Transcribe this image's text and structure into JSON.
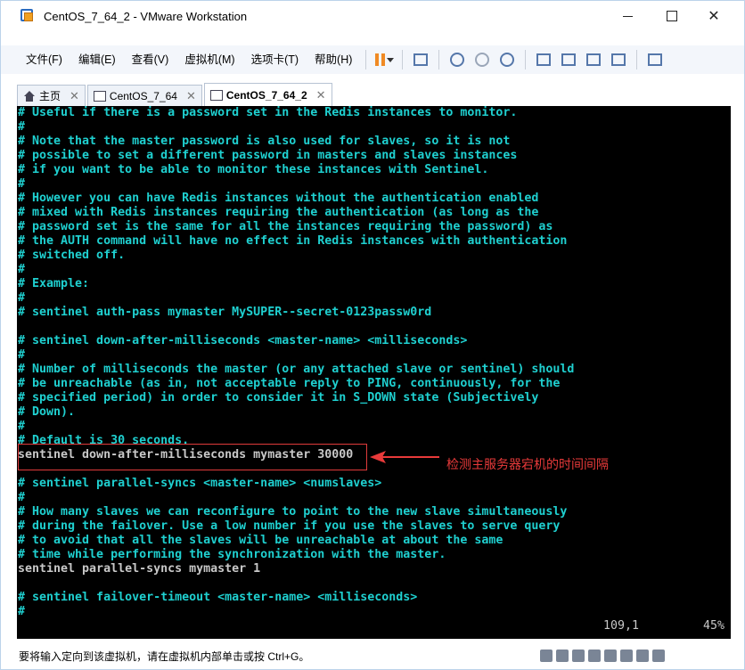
{
  "window": {
    "title": "CentOS_7_64_2 - VMware Workstation",
    "min_symbol": "—",
    "max_symbol": "☐",
    "close_symbol": "✕"
  },
  "menu": {
    "items": [
      "文件(F)",
      "编辑(E)",
      "查看(V)",
      "虚拟机(M)",
      "选项卡(T)",
      "帮助(H)"
    ]
  },
  "toolbar": {
    "icons": [
      "pause-icon",
      "send-keys-icon",
      "snapshot-icon",
      "revert-snapshot-icon",
      "snapshot-manager-icon",
      "library-view-icon",
      "full-screen-icon",
      "unity-icon",
      "console-view-icon"
    ]
  },
  "tabs": [
    {
      "label": "主页",
      "close": "✕"
    },
    {
      "label": "CentOS_7_64",
      "close": "✕"
    },
    {
      "label": "CentOS_7_64_2",
      "close": "✕"
    }
  ],
  "terminal": {
    "lines": [
      "# Useful if there is a password set in the Redis instances to monitor.",
      "#",
      "# Note that the master password is also used for slaves, so it is not",
      "# possible to set a different password in masters and slaves instances",
      "# if you want to be able to monitor these instances with Sentinel.",
      "#",
      "# However you can have Redis instances without the authentication enabled",
      "# mixed with Redis instances requiring the authentication (as long as the",
      "# password set is the same for all the instances requiring the password) as",
      "# the AUTH command will have no effect in Redis instances with authentication",
      "# switched off.",
      "#",
      "# Example:",
      "#",
      "# sentinel auth-pass mymaster MySUPER--secret-0123passw0rd",
      "",
      "# sentinel down-after-milliseconds <master-name> <milliseconds>",
      "#",
      "# Number of milliseconds the master (or any attached slave or sentinel) should",
      "# be unreachable (as in, not acceptable reply to PING, continuously, for the",
      "# specified period) in order to consider it in S_DOWN state (Subjectively",
      "# Down).",
      "#",
      "# Default is 30 seconds.",
      "sentinel down-after-milliseconds mymaster 30000",
      "",
      "# sentinel parallel-syncs <master-name> <numslaves>",
      "#",
      "# How many slaves we can reconfigure to point to the new slave simultaneously",
      "# during the failover. Use a low number if you use the slaves to serve query",
      "# to avoid that all the slaves will be unreachable at about the same",
      "# time while performing the synchronization with the master.",
      "sentinel parallel-syncs mymaster 1",
      "",
      "# sentinel failover-timeout <master-name> <milliseconds>",
      "#"
    ],
    "cursor_pos": "109,1",
    "percent": "45%",
    "text_color": "#1fd0d0",
    "plain_text_color": "#c8c8c8"
  },
  "annotation": {
    "text": "检测主服务器宕机的时间间隔",
    "color": "#e83a3a"
  },
  "statusbar": {
    "text": "要将输入定向到该虚拟机，请在虚拟机内部单击或按 Ctrl+G。"
  }
}
